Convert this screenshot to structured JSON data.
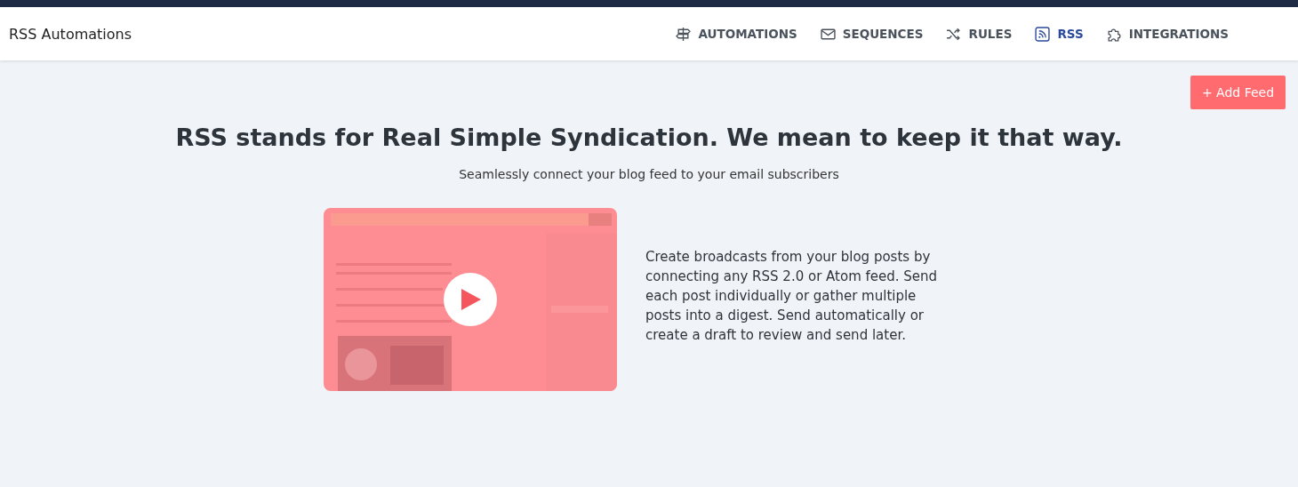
{
  "app_title": "RSS Automations",
  "nav": [
    {
      "label": "AUTOMATIONS",
      "selected": false
    },
    {
      "label": "SEQUENCES",
      "selected": false
    },
    {
      "label": "RULES",
      "selected": false
    },
    {
      "label": "RSS",
      "selected": true
    },
    {
      "label": "INTEGRATIONS",
      "selected": false
    }
  ],
  "add_button": "+ Add Feed",
  "heading": "RSS stands for Real Simple Syndication. We mean to keep it that way.",
  "subheading": "Seamlessly connect your blog feed to your email subscribers",
  "description": "Create broadcasts from your blog posts by connecting any RSS 2.0 or Atom feed. Send each post individually or gather multiple posts into a digest. Send automatically or create a draft to review and send later."
}
